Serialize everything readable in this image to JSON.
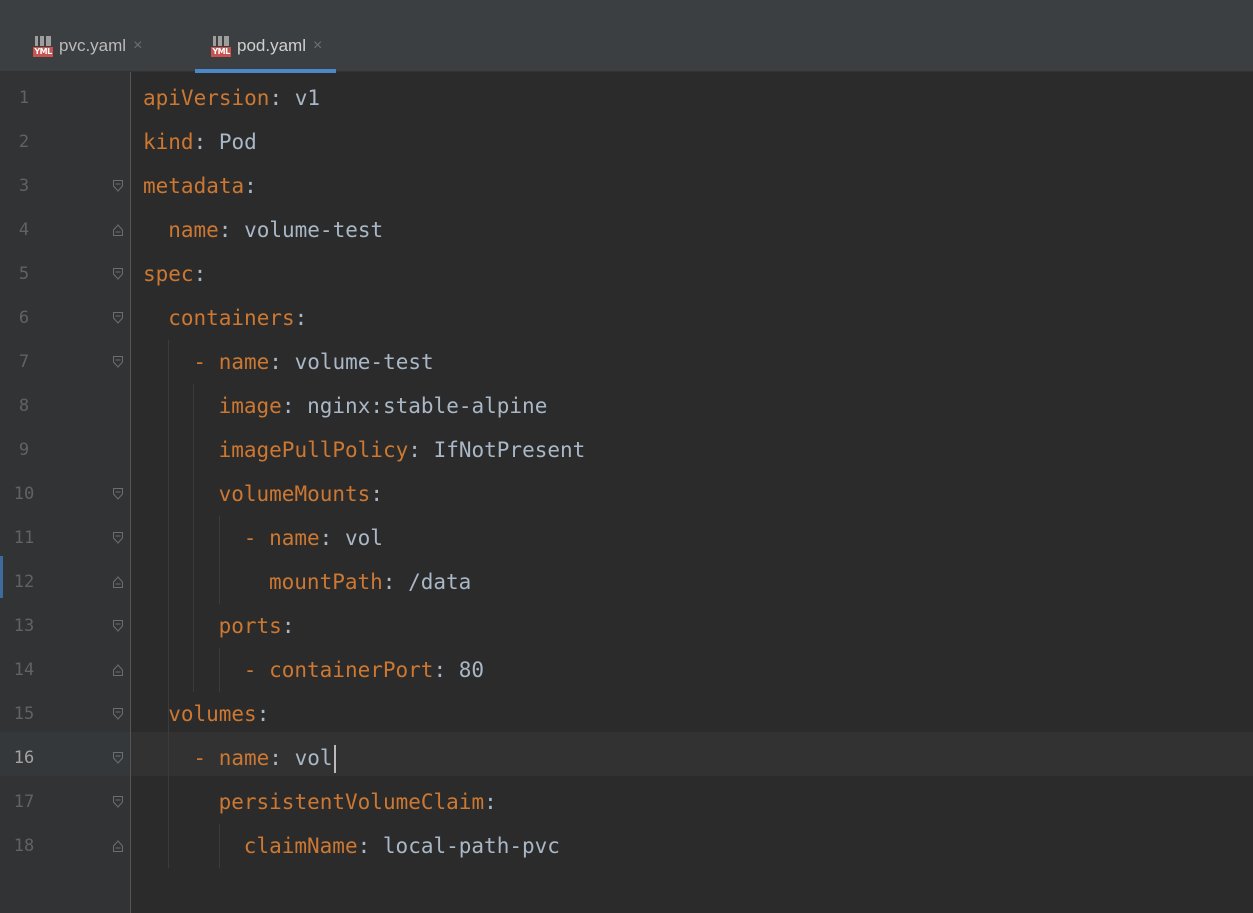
{
  "tabs": [
    {
      "label": "pvc.yaml",
      "icon": "yml-file-icon",
      "icon_badge": "YML",
      "active": false
    },
    {
      "label": "pod.yaml",
      "icon": "yml-file-icon",
      "icon_badge": "YML",
      "active": true
    }
  ],
  "editor": {
    "current_line": 16,
    "lines": [
      {
        "num": "1",
        "key": "apiVersion",
        "value": "v1"
      },
      {
        "num": "2",
        "key": "kind",
        "value": "Pod"
      },
      {
        "num": "3",
        "key": "metadata",
        "value": ""
      },
      {
        "num": "4",
        "key": "name",
        "value": "volume-test"
      },
      {
        "num": "5",
        "key": "spec",
        "value": ""
      },
      {
        "num": "6",
        "key": "containers",
        "value": ""
      },
      {
        "num": "7",
        "key": "name",
        "value": "volume-test"
      },
      {
        "num": "8",
        "key": "image",
        "value": "nginx:stable-alpine"
      },
      {
        "num": "9",
        "key": "imagePullPolicy",
        "value": "IfNotPresent"
      },
      {
        "num": "10",
        "key": "volumeMounts",
        "value": ""
      },
      {
        "num": "11",
        "key": "name",
        "value": "vol"
      },
      {
        "num": "12",
        "key": "mountPath",
        "value": "/data"
      },
      {
        "num": "13",
        "key": "ports",
        "value": ""
      },
      {
        "num": "14",
        "key": "containerPort",
        "value": "80"
      },
      {
        "num": "15",
        "key": "volumes",
        "value": ""
      },
      {
        "num": "16",
        "key": "name",
        "value": "vol"
      },
      {
        "num": "17",
        "key": "persistentVolumeClaim",
        "value": ""
      },
      {
        "num": "18",
        "key": "claimName",
        "value": "local-path-pvc"
      }
    ]
  },
  "colors": {
    "background": "#2b2b2b",
    "gutter": "#313335",
    "key": "#cc7832",
    "value": "#a9b7c6",
    "active_tab_underline": "#4a88c7",
    "yml_badge": "#c75450"
  }
}
